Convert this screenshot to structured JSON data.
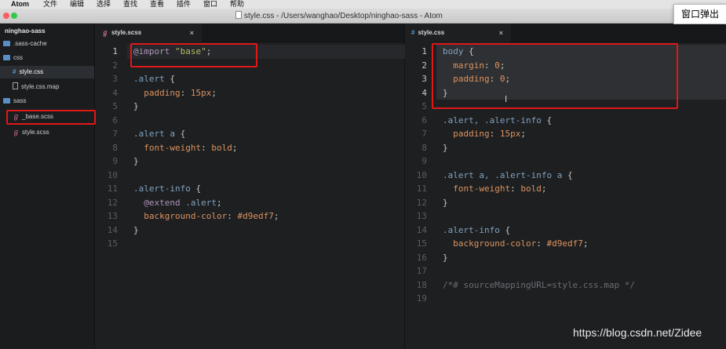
{
  "menubar": {
    "app": "Atom",
    "items": [
      "文件",
      "编辑",
      "选择",
      "查找",
      "查看",
      "插件",
      "窗口",
      "帮助"
    ],
    "search_icon": "magnifier-icon"
  },
  "window": {
    "title": "style.css - /Users/wanghao/Desktop/ninghao-sass - Atom",
    "traffic_colors": [
      "#fc605c",
      "#fdbc40",
      "#34c84a"
    ]
  },
  "popup": {
    "label": "窗口弹出"
  },
  "tree": {
    "root": "ninghao-sass",
    "items": [
      {
        "label": ".sass-cache",
        "kind": "folder"
      },
      {
        "label": "css",
        "kind": "folder"
      },
      {
        "label": "style.css",
        "kind": "css"
      },
      {
        "label": "style.css.map",
        "kind": "file"
      },
      {
        "label": "sass",
        "kind": "folder"
      },
      {
        "label": "_base.scss",
        "kind": "sass"
      },
      {
        "label": "style.scss",
        "kind": "sass"
      }
    ]
  },
  "left_pane": {
    "tab": {
      "label": "style.scss",
      "close": "×"
    },
    "line_numbers": [
      "1",
      "2",
      "3",
      "4",
      "5",
      "6",
      "7",
      "8",
      "9",
      "10",
      "11",
      "12",
      "13",
      "14",
      "15"
    ],
    "code": [
      [
        [
          "k",
          "@import"
        ],
        [
          "v",
          " "
        ],
        [
          "s",
          "\"base\""
        ],
        [
          "v",
          ";"
        ]
      ],
      [],
      [
        [
          "sel",
          ".alert"
        ],
        [
          "v",
          " {"
        ]
      ],
      [
        [
          "v",
          "  "
        ],
        [
          "p",
          "padding"
        ],
        [
          "v",
          ": "
        ],
        [
          "n",
          "15px"
        ],
        [
          "v",
          ";"
        ]
      ],
      [
        [
          "v",
          "}"
        ]
      ],
      [],
      [
        [
          "sel",
          ".alert a"
        ],
        [
          "v",
          " {"
        ]
      ],
      [
        [
          "v",
          "  "
        ],
        [
          "p",
          "font-weight"
        ],
        [
          "v",
          ": "
        ],
        [
          "n",
          "bold"
        ],
        [
          "v",
          ";"
        ]
      ],
      [
        [
          "v",
          "}"
        ]
      ],
      [],
      [
        [
          "sel",
          ".alert-info"
        ],
        [
          "v",
          " {"
        ]
      ],
      [
        [
          "v",
          "  "
        ],
        [
          "k",
          "@extend"
        ],
        [
          "v",
          " "
        ],
        [
          "sel",
          ".alert"
        ],
        [
          "v",
          ";"
        ]
      ],
      [
        [
          "v",
          "  "
        ],
        [
          "p",
          "background-color"
        ],
        [
          "v",
          ": "
        ],
        [
          "n",
          "#d9edf7"
        ],
        [
          "v",
          ";"
        ]
      ],
      [
        [
          "v",
          "}"
        ]
      ],
      []
    ]
  },
  "right_pane": {
    "tab": {
      "label": "style.css",
      "close": "×"
    },
    "line_numbers": [
      "1",
      "2",
      "3",
      "4",
      "5",
      "6",
      "7",
      "8",
      "9",
      "10",
      "11",
      "12",
      "13",
      "14",
      "15",
      "16",
      "17",
      "18",
      "19"
    ],
    "code": [
      [
        [
          "sel",
          "body"
        ],
        [
          "v",
          " {"
        ]
      ],
      [
        [
          "v",
          "  "
        ],
        [
          "p",
          "margin"
        ],
        [
          "v",
          ": "
        ],
        [
          "n",
          "0"
        ],
        [
          "v",
          ";"
        ]
      ],
      [
        [
          "v",
          "  "
        ],
        [
          "p",
          "padding"
        ],
        [
          "v",
          ": "
        ],
        [
          "n",
          "0"
        ],
        [
          "v",
          ";"
        ]
      ],
      [
        [
          "v",
          "}"
        ]
      ],
      [],
      [
        [
          "sel",
          ".alert, .alert-info"
        ],
        [
          "v",
          " {"
        ]
      ],
      [
        [
          "v",
          "  "
        ],
        [
          "p",
          "padding"
        ],
        [
          "v",
          ": "
        ],
        [
          "n",
          "15px"
        ],
        [
          "v",
          ";"
        ]
      ],
      [
        [
          "v",
          "}"
        ]
      ],
      [],
      [
        [
          "sel",
          ".alert a, .alert-info a"
        ],
        [
          "v",
          " {"
        ]
      ],
      [
        [
          "v",
          "  "
        ],
        [
          "p",
          "font-weight"
        ],
        [
          "v",
          ": "
        ],
        [
          "n",
          "bold"
        ],
        [
          "v",
          ";"
        ]
      ],
      [
        [
          "v",
          "}"
        ]
      ],
      [],
      [
        [
          "sel",
          ".alert-info"
        ],
        [
          "v",
          " {"
        ]
      ],
      [
        [
          "v",
          "  "
        ],
        [
          "p",
          "background-color"
        ],
        [
          "v",
          ": "
        ],
        [
          "n",
          "#d9edf7"
        ],
        [
          "v",
          ";"
        ]
      ],
      [
        [
          "v",
          "}"
        ]
      ],
      [],
      [
        [
          "c",
          "/*# sourceMappingURL=style.css.map */"
        ]
      ],
      []
    ]
  },
  "watermark": "https://blog.csdn.net/Zidee",
  "colors": {
    "annotation_red": "#e01818",
    "editor_bg": "#1d1f21"
  }
}
